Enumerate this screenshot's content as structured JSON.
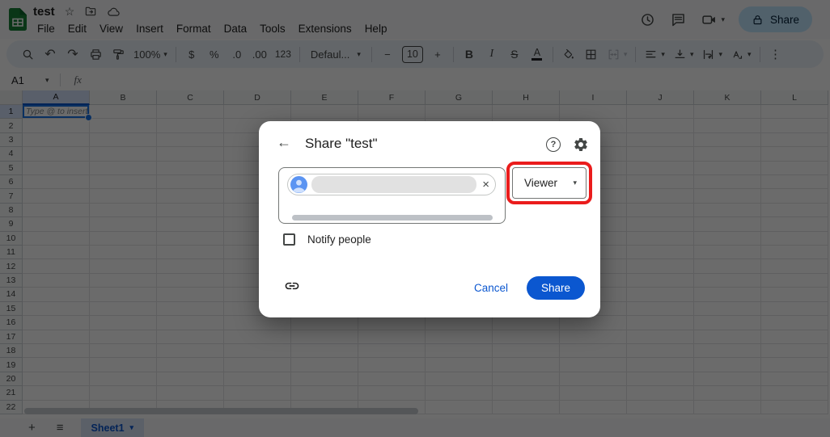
{
  "titlebar": {
    "doc_title": "test",
    "menus": [
      "File",
      "Edit",
      "View",
      "Insert",
      "Format",
      "Data",
      "Tools",
      "Extensions",
      "Help"
    ],
    "share_button": "Share"
  },
  "toolbar": {
    "zoom_value": "100%",
    "currency": "$",
    "percent": "%",
    "decrease_decimal": ".0",
    "increase_decimal": ".00",
    "more_formats": "123",
    "font_name": "Defaul...",
    "decrease_font": "−",
    "font_size": "10",
    "increase_font": "+",
    "bold": "B",
    "italic": "I",
    "strikethrough": "S",
    "text_color": "A"
  },
  "formula_bar": {
    "cell_reference": "A1",
    "fx_label": "fx"
  },
  "grid": {
    "column_headers": [
      "A",
      "B",
      "C",
      "D",
      "E",
      "F",
      "G",
      "H",
      "I",
      "J",
      "K",
      "L"
    ],
    "row_count": 22,
    "selected_column": "A",
    "selected_row": "1",
    "selected_cell": "A1",
    "cell_a1_placeholder": "Type @ to insert"
  },
  "share_dialog": {
    "title": "Share \"test\"",
    "permission_selected": "Viewer",
    "notify_label": "Notify people",
    "cancel_label": "Cancel",
    "share_label": "Share",
    "annotation_color": "#ea1c1c"
  },
  "sheet_tabs": {
    "active_tab": "Sheet1"
  },
  "icons": {
    "star": "☆",
    "undo": "↶",
    "redo": "↷",
    "caret_down": "▾",
    "more_vertical": "⋮",
    "back_arrow": "←",
    "close": "×",
    "plus": "+",
    "all_sheets": "≡",
    "help": "?"
  },
  "colors": {
    "accent_blue": "#0b57d0",
    "selection_blue": "#1a73e8",
    "share_pill_bg": "#c2e7ff",
    "toolbar_bg": "#edf2fa",
    "selected_header_bg": "#d3e3fd",
    "logo_green": "#188038",
    "scrim": "rgba(0,0,0,0.58)"
  }
}
